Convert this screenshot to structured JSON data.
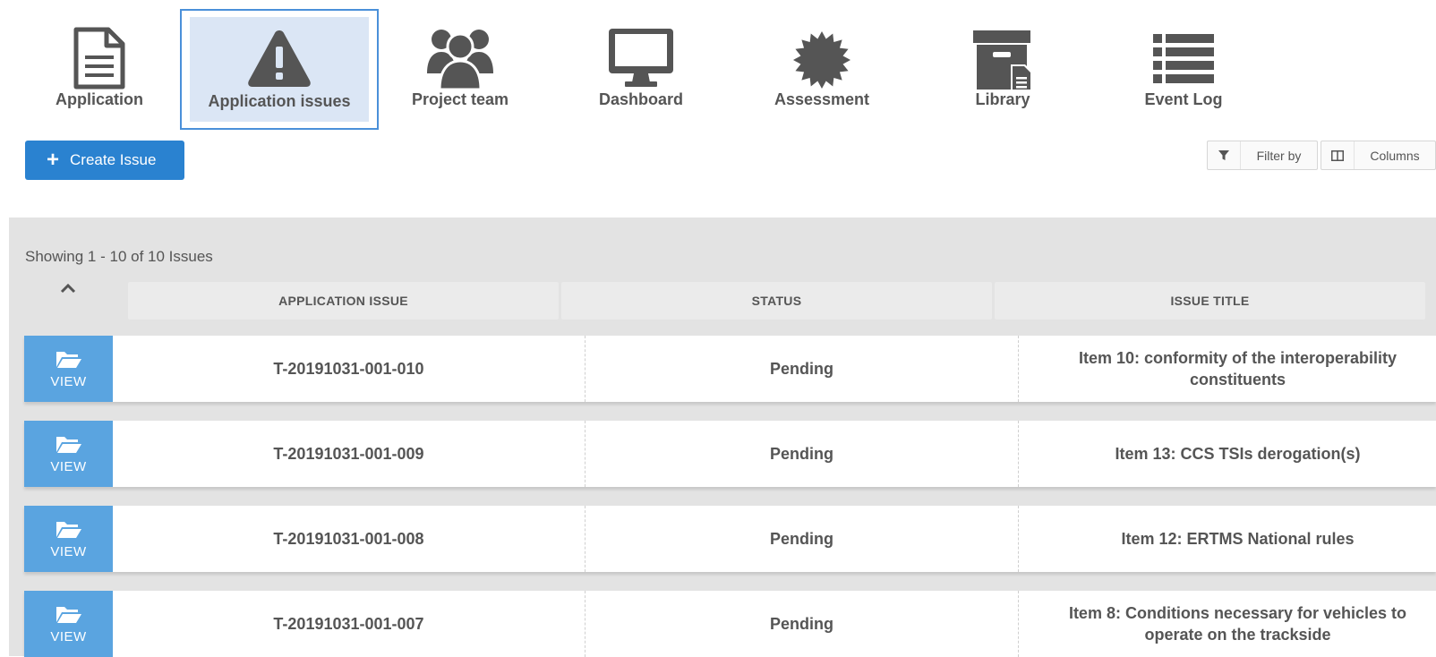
{
  "nav": {
    "items": [
      {
        "label": "Application",
        "icon": "document-icon"
      },
      {
        "label": "Application issues",
        "icon": "warning-icon",
        "active": true
      },
      {
        "label": "Project team",
        "icon": "team-icon"
      },
      {
        "label": "Dashboard",
        "icon": "monitor-icon"
      },
      {
        "label": "Assessment",
        "icon": "badge-icon"
      },
      {
        "label": "Library",
        "icon": "archive-icon"
      },
      {
        "label": "Event Log",
        "icon": "list-icon"
      }
    ]
  },
  "toolbar": {
    "create_label": "Create Issue",
    "filter_label": "Filter by",
    "columns_label": "Columns"
  },
  "grid": {
    "showing_text": "Showing 1 - 10 of 10 Issues",
    "columns": [
      "APPLICATION ISSUE",
      "STATUS",
      "ISSUE TITLE"
    ],
    "view_label": "VIEW",
    "rows": [
      {
        "issue": "T-20191031-001-010",
        "status": "Pending",
        "title": "Item 10: conformity of the interoperability constituents"
      },
      {
        "issue": "T-20191031-001-009",
        "status": "Pending",
        "title": "Item 13: CCS TSIs derogation(s)"
      },
      {
        "issue": "T-20191031-001-008",
        "status": "Pending",
        "title": "Item 12: ERTMS National rules"
      },
      {
        "issue": "T-20191031-001-007",
        "status": "Pending",
        "title": "Item 8: Conditions necessary for vehicles to operate on the trackside"
      }
    ]
  },
  "colors": {
    "accent": "#2a82d0",
    "view_button": "#5aa4e0",
    "active_nav_bg": "#dbe6f5",
    "active_nav_border": "#4a90d9",
    "panel_bg": "#e3e3e3"
  }
}
